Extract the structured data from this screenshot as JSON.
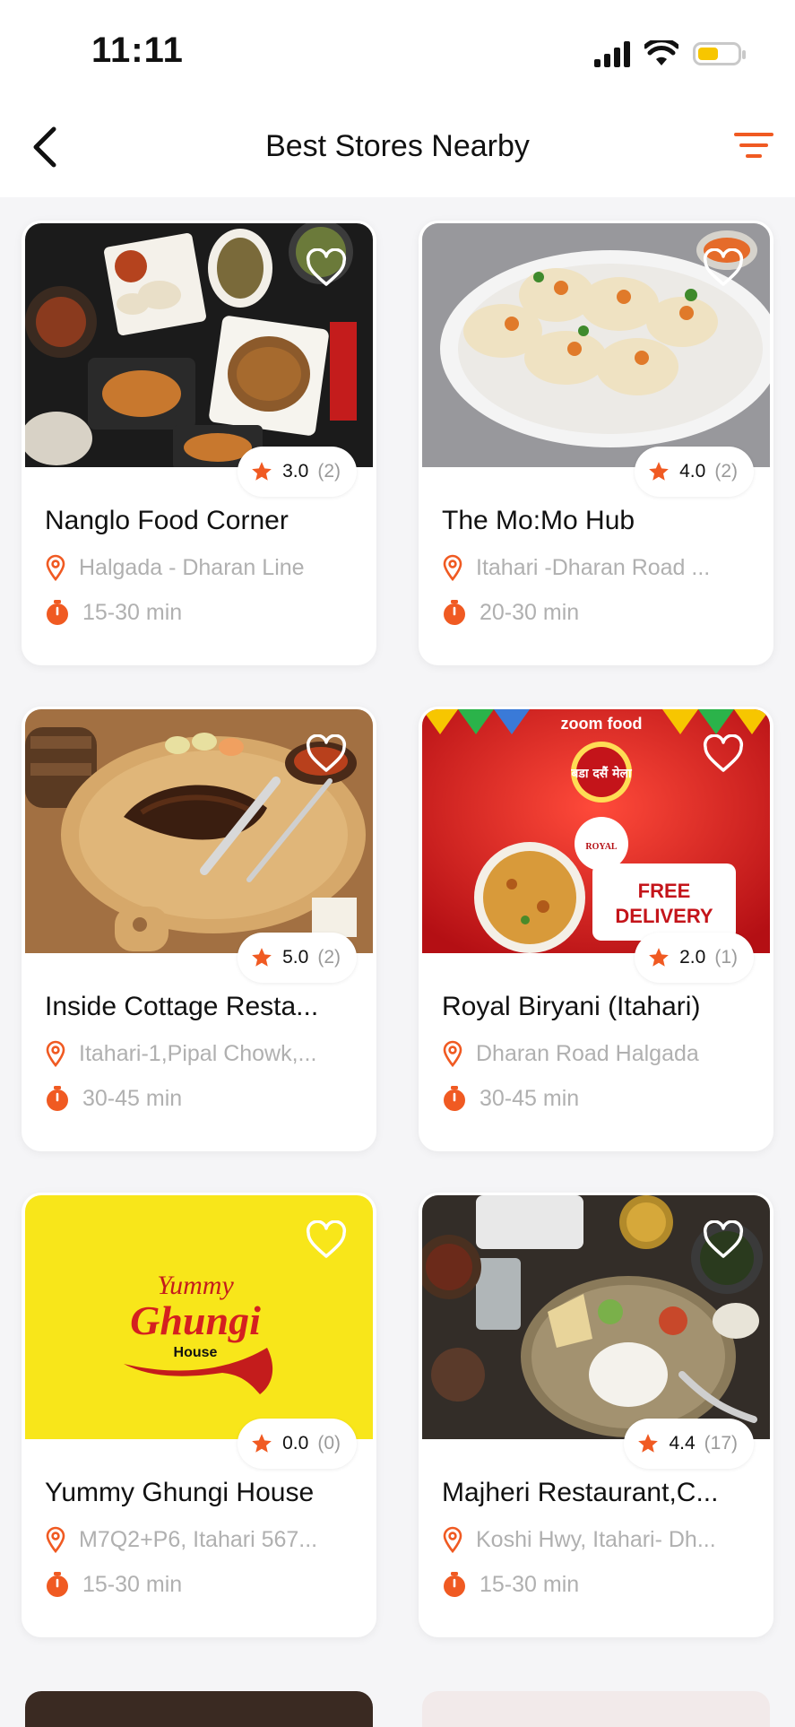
{
  "status_bar": {
    "time": "11:11"
  },
  "header": {
    "title": "Best Stores Nearby"
  },
  "colors": {
    "accent": "#f05a22",
    "muted": "#b0b0b0"
  },
  "stores": [
    {
      "name": "Nanglo Food Corner",
      "address": "Halgada - Dharan Line",
      "time": "15-30 min",
      "rating": "3.0",
      "reviews": "(2)"
    },
    {
      "name": "The Mo:Mo Hub",
      "address": "Itahari -Dharan Road ...",
      "time": "20-30 min",
      "rating": "4.0",
      "reviews": "(2)"
    },
    {
      "name": "Inside Cottage Resta...",
      "address": "Itahari-1,Pipal Chowk,...",
      "time": "30-45 min",
      "rating": "5.0",
      "reviews": "(2)"
    },
    {
      "name": "Royal Biryani (Itahari)",
      "address": "Dharan Road Halgada",
      "time": "30-45 min",
      "rating": "2.0",
      "reviews": "(1)"
    },
    {
      "name": "Yummy Ghungi House",
      "address": "M7Q2+P6, Itahari 567...",
      "time": "15-30 min",
      "rating": "0.0",
      "reviews": "(0)"
    },
    {
      "name": "Majheri Restaurant,C...",
      "address": "Koshi Hwy, Itahari- Dh...",
      "time": "15-30 min",
      "rating": "4.4",
      "reviews": "(17)"
    }
  ],
  "promo": {
    "brand": "zoom food",
    "badge": "बडा दसैं मेला",
    "logo": "ROYAL",
    "free_delivery_1": "FREE",
    "free_delivery_2": "DELIVERY"
  },
  "ghungi_logo": {
    "line1": "Yummy",
    "line2": "Ghungi",
    "line3": "House"
  }
}
